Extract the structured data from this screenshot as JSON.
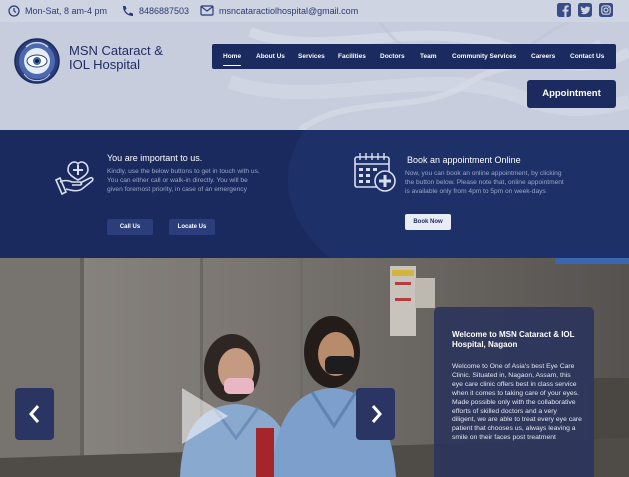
{
  "topbar": {
    "hours": "Mon-Sat, 8 am-4 pm",
    "phone": "8486887503",
    "email": "msncataractiolhospital@gmail.com"
  },
  "brand": {
    "line1": "MSN Cataract &",
    "line2": "IOL Hospital"
  },
  "nav": {
    "items": [
      "Home",
      "About Us",
      "Services",
      "Facilities",
      "Doctors",
      "Team",
      "Community Services",
      "Careers",
      "Contact Us"
    ],
    "active": "Home"
  },
  "appointment_button": "Appointment",
  "info_left": {
    "title": "You are important to us.",
    "text": "Kindly, use the below buttons to get in touch with us. You can either call or walk-in directly. You will be given foremost priority, in case of an emergency",
    "btn_call": "Call Us",
    "btn_locate": "Locate Us"
  },
  "info_right": {
    "title": "Book an appointment Online",
    "text": "Now, you can book an online appointment, by clicking the button below. Please note that, online appointment is available only from 4pm to 5pm on week-days",
    "btn_book": "Book Now"
  },
  "welcome": {
    "title": "Welcome to MSN Cataract & IOL Hospital, Nagaon",
    "body": "Welcome to One of Asia's best Eye Care Clinic. Situated in, Nagaon, Assam, this eye care clinic offers best in class service when it comes to taking care of your eyes. Made possible only with the collaborative efforts of skilled doctors and a very diligent, we are able to treat every eye care patient that chooses us, always leaving a smile on their faces post treatment"
  },
  "colors": {
    "navy": "#1b2a5f",
    "band": "#1a2a5e",
    "topbar_text": "#283a73"
  },
  "icons": {
    "clock": "clock-icon",
    "phone": "phone-icon",
    "email": "mail-icon",
    "facebook": "facebook-icon",
    "twitter": "twitter-icon",
    "instagram": "instagram-icon",
    "hand": "hand-care-icon",
    "calendar": "calendar-plus-icon",
    "prev": "chevron-left-icon",
    "next": "chevron-right-icon",
    "play": "play-icon"
  }
}
